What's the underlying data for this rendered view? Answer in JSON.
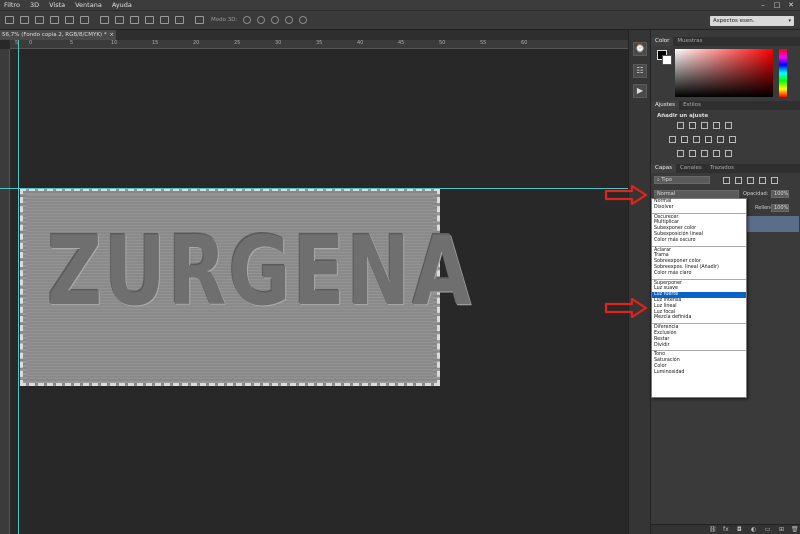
{
  "menu": [
    "Filtro",
    "3D",
    "Vista",
    "Ventana",
    "Ayuda"
  ],
  "window_controls": [
    "–",
    "□",
    "✕"
  ],
  "options_bar": {
    "mode3d_label": "Modo 3D:",
    "workspace": "Aspectos esen."
  },
  "document_tab": {
    "title": "56,7% (Fondo copia 2, RGB/8/CMYK) *",
    "close": "×"
  },
  "ruler_labels": [
    "5",
    "0",
    "5",
    "10",
    "15",
    "20",
    "25",
    "30",
    "35",
    "40",
    "45",
    "50",
    "55",
    "60"
  ],
  "canvas": {
    "image_text": "ZURGENA"
  },
  "panels": {
    "color": {
      "tabs": [
        "Color",
        "Muestras"
      ]
    },
    "ajustes": {
      "tabs": [
        "Ajustes",
        "Estilos"
      ],
      "title": "Añadir un ajuste"
    },
    "capas": {
      "tabs": [
        "Capas",
        "Canales",
        "Trazados"
      ],
      "kind_filter": "Tipo",
      "blend_mode": "Normal",
      "opacity_label": "Opacidad:",
      "opacity_value": "100%",
      "fill_label": "Relleno:",
      "fill_value": "100%"
    }
  },
  "blend_modes": [
    [
      "Normal",
      "Disolver"
    ],
    [
      "Oscurecer",
      "Multiplicar",
      "Subexponer color",
      "Subexposición lineal",
      "Color más oscuro"
    ],
    [
      "Aclarar",
      "Trama",
      "Sobreexponer color",
      "Sobreexpos. lineal (Añadir)",
      "Color más claro"
    ],
    [
      "Superponer",
      "Luz suave",
      "Luz fuerte",
      "Luz intensa",
      "Luz lineal",
      "Luz focal",
      "Mezcla definida"
    ],
    [
      "Diferencia",
      "Exclusión",
      "Restar",
      "Dividir"
    ],
    [
      "Tono",
      "Saturación",
      "Color",
      "Luminosidad"
    ]
  ],
  "selected_blend_mode": "Luz fuerte",
  "layers_bottom_icons": [
    "link-icon",
    "fx-icon",
    "mask-icon",
    "adjustment-icon",
    "folder-icon",
    "new-layer-icon",
    "trash-icon"
  ],
  "colors": {
    "accent_selection": "#0a63c9",
    "guide": "#4fc3c8",
    "arrow": "#e0231c"
  }
}
